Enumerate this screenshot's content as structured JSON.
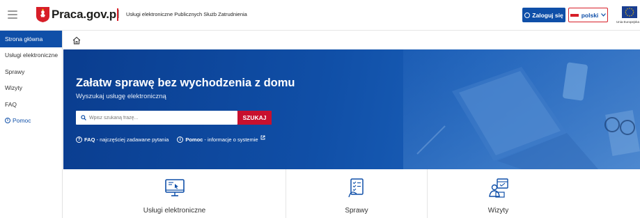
{
  "header": {
    "brand": "Praca.gov.pl",
    "subtitle": "Usługi elektroniczne Publicznych Służb Zatrudnienia",
    "login_label": "Zaloguj się",
    "language_label": "polski",
    "eu_label": "Unia Europejska",
    "colors": {
      "primary": "#0f4fa8",
      "accent": "#d71e28"
    }
  },
  "sidebar": {
    "items": [
      {
        "label": "Strona główna",
        "active": true
      },
      {
        "label": "Usługi elektroniczne",
        "active": false
      },
      {
        "label": "Sprawy",
        "active": false
      },
      {
        "label": "Wizyty",
        "active": false
      },
      {
        "label": "FAQ",
        "active": false
      }
    ],
    "help_label": "Pomoc"
  },
  "hero": {
    "title": "Załatw sprawę bez wychodzenia z domu",
    "subtitle": "Wyszukaj usługę elektroniczną",
    "search_placeholder": "Wpisz szukaną frazę...",
    "search_button": "SZUKAJ",
    "faq_strong": "FAQ",
    "faq_text": " - najczęściej zadawane pytania",
    "help_strong": "Pomoc",
    "help_text": " - informacje o systemie"
  },
  "tiles": [
    {
      "label": "Usługi elektroniczne",
      "icon": "computer-icon"
    },
    {
      "label": "Sprawy",
      "icon": "checklist-icon"
    },
    {
      "label": "Wizyty",
      "icon": "calendar-person-icon"
    }
  ]
}
